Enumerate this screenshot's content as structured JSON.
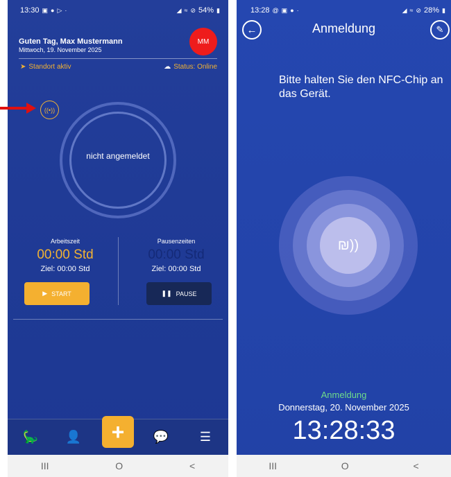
{
  "screen1": {
    "statusbar": {
      "time": "13:30",
      "battery": "54%"
    },
    "greeting": "Guten Tag, Max Mustermann",
    "date": "Mittwoch, 19. November 2025",
    "avatar_initials": "MM",
    "location_text": "Standort aktiv",
    "status_text": "Status: Online",
    "nfc_icon": "nfc-icon",
    "ring_label": "nicht angemeldet",
    "work": {
      "caption": "Arbeitszeit",
      "time": "00:00 Std",
      "goal": "Ziel: 00:00 Std",
      "button": "START"
    },
    "pause": {
      "caption": "Pausenzeiten",
      "time": "00:00 Std",
      "goal": "Ziel: 00:00  Std",
      "button": "PAUSE"
    },
    "navbar": {
      "items": [
        "dino-icon",
        "user-clock-icon",
        "add-icon",
        "chat-icon",
        "menu-icon"
      ]
    },
    "colors": {
      "background": "#233e9a",
      "accent": "#f4b030",
      "avatar": "#ee1c1c",
      "arrow": "#e01010"
    }
  },
  "screen2": {
    "statusbar": {
      "time": "13:28",
      "battery": "28%"
    },
    "title": "Anmeldung",
    "instruction": "Bitte halten Sie den NFC-Chip an das Gerät.",
    "mode_label": "Anmeldung",
    "full_date": "Donnerstag, 20. November 2025",
    "clock": "13:28:33",
    "colors": {
      "background": "#2547b0",
      "mode_label": "#6fdc8a"
    }
  },
  "system_nav": {
    "recent": "III",
    "home": "O",
    "back": "<"
  }
}
